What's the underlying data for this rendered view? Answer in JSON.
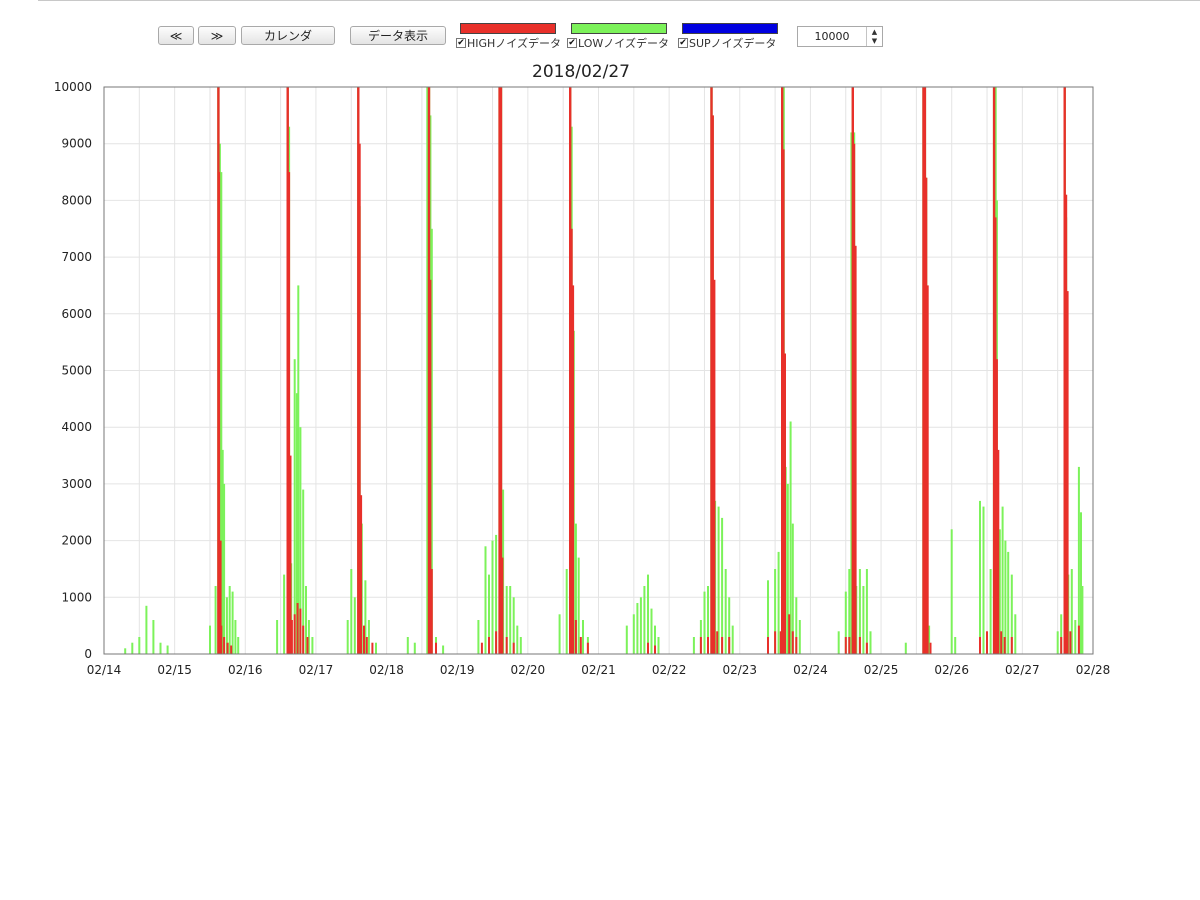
{
  "toolbar": {
    "prev_label": "≪",
    "next_label": "≫",
    "calendar_label": "カレンダ",
    "show_data_label": "データ表示",
    "range_value": "10000"
  },
  "legend": [
    {
      "label": "HIGHノイズデータ",
      "color": "#e8302a",
      "checked": true
    },
    {
      "label": "LOWノイズデータ",
      "color": "#7cf25a",
      "checked": true
    },
    {
      "label": "SUPノイズデータ",
      "color": "#0000e0",
      "checked": true
    }
  ],
  "chart_data": {
    "type": "bar",
    "title": "2018/02/27",
    "xlabel": "",
    "ylabel": "",
    "ylim": [
      0,
      10000
    ],
    "yticks": [
      "0",
      "1000",
      "2000",
      "3000",
      "4000",
      "5000",
      "6000",
      "7000",
      "8000",
      "9000",
      "10000"
    ],
    "x_ticks": [
      "02/14",
      "02/15",
      "02/16",
      "02/17",
      "02/18",
      "02/19",
      "02/20",
      "02/21",
      "02/22",
      "02/23",
      "02/24",
      "02/25",
      "02/26",
      "02/27",
      "02/28"
    ],
    "xlim": [
      0,
      14
    ],
    "grid": true,
    "series": [
      {
        "name": "HIGHノイズデータ",
        "color": "#e8302a",
        "points": [
          [
            1.62,
            10000
          ],
          [
            1.63,
            8500
          ],
          [
            1.65,
            2000
          ],
          [
            1.66,
            500
          ],
          [
            1.7,
            300
          ],
          [
            1.75,
            200
          ],
          [
            1.8,
            150
          ],
          [
            2.6,
            10000
          ],
          [
            2.62,
            8500
          ],
          [
            2.64,
            3500
          ],
          [
            2.66,
            600
          ],
          [
            2.7,
            700
          ],
          [
            2.74,
            900
          ],
          [
            2.78,
            800
          ],
          [
            2.82,
            500
          ],
          [
            2.88,
            300
          ],
          [
            3.6,
            10000
          ],
          [
            3.62,
            9000
          ],
          [
            3.64,
            2800
          ],
          [
            3.68,
            500
          ],
          [
            3.72,
            300
          ],
          [
            3.8,
            200
          ],
          [
            4.6,
            10000
          ],
          [
            4.62,
            6600
          ],
          [
            4.64,
            1500
          ],
          [
            4.7,
            200
          ],
          [
            5.35,
            200
          ],
          [
            5.45,
            300
          ],
          [
            5.55,
            400
          ],
          [
            5.6,
            10000
          ],
          [
            5.62,
            10000
          ],
          [
            5.64,
            1700
          ],
          [
            5.7,
            300
          ],
          [
            5.8,
            200
          ],
          [
            6.6,
            10000
          ],
          [
            6.62,
            7500
          ],
          [
            6.64,
            6500
          ],
          [
            6.68,
            600
          ],
          [
            6.75,
            300
          ],
          [
            6.85,
            200
          ],
          [
            7.7,
            200
          ],
          [
            7.8,
            150
          ],
          [
            8.45,
            300
          ],
          [
            8.55,
            300
          ],
          [
            8.6,
            10000
          ],
          [
            8.62,
            9500
          ],
          [
            8.64,
            6600
          ],
          [
            8.68,
            400
          ],
          [
            8.75,
            300
          ],
          [
            8.85,
            300
          ],
          [
            9.4,
            300
          ],
          [
            9.5,
            400
          ],
          [
            9.58,
            400
          ],
          [
            9.6,
            10000
          ],
          [
            9.62,
            8900
          ],
          [
            9.64,
            5300
          ],
          [
            9.7,
            700
          ],
          [
            9.75,
            400
          ],
          [
            9.8,
            300
          ],
          [
            10.5,
            300
          ],
          [
            10.55,
            300
          ],
          [
            10.6,
            10000
          ],
          [
            10.62,
            9000
          ],
          [
            10.64,
            7200
          ],
          [
            10.7,
            300
          ],
          [
            10.8,
            200
          ],
          [
            11.6,
            10000
          ],
          [
            11.62,
            10000
          ],
          [
            11.64,
            8400
          ],
          [
            11.66,
            6500
          ],
          [
            11.7,
            200
          ],
          [
            12.4,
            300
          ],
          [
            12.5,
            400
          ],
          [
            12.6,
            10000
          ],
          [
            12.62,
            7700
          ],
          [
            12.64,
            5200
          ],
          [
            12.66,
            3600
          ],
          [
            12.7,
            400
          ],
          [
            12.75,
            300
          ],
          [
            12.85,
            300
          ],
          [
            13.55,
            300
          ],
          [
            13.6,
            10000
          ],
          [
            13.62,
            8100
          ],
          [
            13.64,
            6400
          ],
          [
            13.68,
            400
          ],
          [
            13.8,
            500
          ]
        ]
      },
      {
        "name": "LOWノイズデータ",
        "color": "#7cf25a",
        "points": [
          [
            0.3,
            100
          ],
          [
            0.4,
            200
          ],
          [
            0.5,
            300
          ],
          [
            0.6,
            850
          ],
          [
            0.7,
            600
          ],
          [
            0.8,
            200
          ],
          [
            0.9,
            150
          ],
          [
            1.5,
            500
          ],
          [
            1.58,
            1200
          ],
          [
            1.62,
            10000
          ],
          [
            1.64,
            9000
          ],
          [
            1.66,
            8500
          ],
          [
            1.68,
            3600
          ],
          [
            1.7,
            3000
          ],
          [
            1.74,
            1000
          ],
          [
            1.78,
            1200
          ],
          [
            1.82,
            1100
          ],
          [
            1.86,
            600
          ],
          [
            1.9,
            300
          ],
          [
            2.45,
            600
          ],
          [
            2.55,
            1400
          ],
          [
            2.6,
            10000
          ],
          [
            2.62,
            9300
          ],
          [
            2.65,
            1600
          ],
          [
            2.7,
            5200
          ],
          [
            2.73,
            4600
          ],
          [
            2.75,
            6500
          ],
          [
            2.78,
            4000
          ],
          [
            2.82,
            2900
          ],
          [
            2.86,
            1200
          ],
          [
            2.9,
            600
          ],
          [
            2.95,
            300
          ],
          [
            3.45,
            600
          ],
          [
            3.5,
            1500
          ],
          [
            3.55,
            1000
          ],
          [
            3.6,
            10000
          ],
          [
            3.62,
            7900
          ],
          [
            3.65,
            2300
          ],
          [
            3.7,
            1300
          ],
          [
            3.75,
            600
          ],
          [
            3.85,
            200
          ],
          [
            4.3,
            300
          ],
          [
            4.4,
            200
          ],
          [
            4.58,
            10000
          ],
          [
            4.6,
            10000
          ],
          [
            4.62,
            9500
          ],
          [
            4.64,
            7500
          ],
          [
            4.7,
            300
          ],
          [
            4.8,
            150
          ],
          [
            5.3,
            600
          ],
          [
            5.4,
            1900
          ],
          [
            5.45,
            1400
          ],
          [
            5.5,
            2000
          ],
          [
            5.55,
            2100
          ],
          [
            5.6,
            10000
          ],
          [
            5.62,
            10000
          ],
          [
            5.65,
            2900
          ],
          [
            5.7,
            1200
          ],
          [
            5.75,
            1200
          ],
          [
            5.8,
            1000
          ],
          [
            5.85,
            500
          ],
          [
            5.9,
            300
          ],
          [
            6.45,
            700
          ],
          [
            6.55,
            1500
          ],
          [
            6.6,
            10000
          ],
          [
            6.62,
            9300
          ],
          [
            6.65,
            5700
          ],
          [
            6.68,
            2300
          ],
          [
            6.72,
            1700
          ],
          [
            6.78,
            600
          ],
          [
            6.85,
            300
          ],
          [
            7.4,
            500
          ],
          [
            7.5,
            700
          ],
          [
            7.55,
            900
          ],
          [
            7.6,
            1000
          ],
          [
            7.65,
            1200
          ],
          [
            7.7,
            1400
          ],
          [
            7.75,
            800
          ],
          [
            7.8,
            500
          ],
          [
            7.85,
            300
          ],
          [
            8.35,
            300
          ],
          [
            8.45,
            600
          ],
          [
            8.5,
            1100
          ],
          [
            8.55,
            1200
          ],
          [
            8.6,
            10000
          ],
          [
            8.62,
            9500
          ],
          [
            8.65,
            2700
          ],
          [
            8.7,
            2600
          ],
          [
            8.75,
            2400
          ],
          [
            8.8,
            1500
          ],
          [
            8.85,
            1000
          ],
          [
            8.9,
            500
          ],
          [
            9.4,
            1300
          ],
          [
            9.5,
            1500
          ],
          [
            9.55,
            1800
          ],
          [
            9.6,
            10000
          ],
          [
            9.62,
            10000
          ],
          [
            9.65,
            3300
          ],
          [
            9.68,
            3000
          ],
          [
            9.72,
            4100
          ],
          [
            9.75,
            2300
          ],
          [
            9.8,
            1000
          ],
          [
            9.85,
            600
          ],
          [
            10.4,
            400
          ],
          [
            10.5,
            1100
          ],
          [
            10.55,
            1500
          ],
          [
            10.58,
            9200
          ],
          [
            10.6,
            10000
          ],
          [
            10.62,
            9200
          ],
          [
            10.65,
            1200
          ],
          [
            10.7,
            1500
          ],
          [
            10.75,
            1200
          ],
          [
            10.8,
            1500
          ],
          [
            10.85,
            400
          ],
          [
            11.35,
            200
          ],
          [
            11.6,
            10000
          ],
          [
            11.62,
            10000
          ],
          [
            11.64,
            8400
          ],
          [
            11.68,
            500
          ],
          [
            12.0,
            2200
          ],
          [
            12.05,
            300
          ],
          [
            12.4,
            2700
          ],
          [
            12.45,
            2600
          ],
          [
            12.55,
            1500
          ],
          [
            12.6,
            10000
          ],
          [
            12.62,
            10000
          ],
          [
            12.64,
            8000
          ],
          [
            12.68,
            2200
          ],
          [
            12.72,
            2600
          ],
          [
            12.76,
            2000
          ],
          [
            12.8,
            1800
          ],
          [
            12.85,
            1400
          ],
          [
            12.9,
            700
          ],
          [
            13.5,
            400
          ],
          [
            13.55,
            700
          ],
          [
            13.6,
            10000
          ],
          [
            13.62,
            7700
          ],
          [
            13.65,
            1400
          ],
          [
            13.7,
            1500
          ],
          [
            13.75,
            600
          ],
          [
            13.8,
            3300
          ],
          [
            13.83,
            2500
          ],
          [
            13.85,
            1200
          ]
        ]
      },
      {
        "name": "SUPノイズデータ",
        "color": "#0000e0",
        "points": []
      }
    ]
  }
}
